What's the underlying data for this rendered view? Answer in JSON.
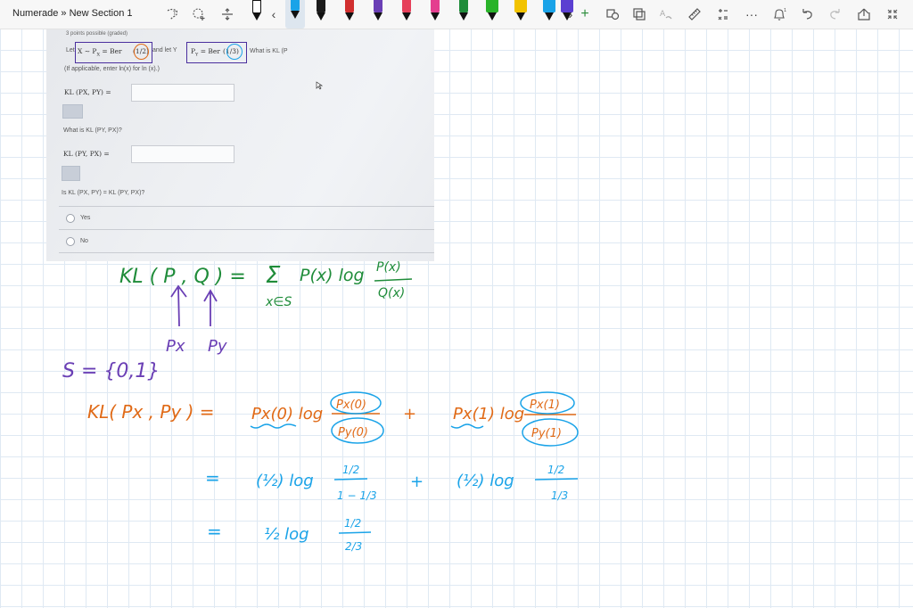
{
  "window": {
    "title": "Numerade » New Section 1"
  },
  "toolbar": {
    "icons": [
      "lasso-select-icon",
      "add-space-icon",
      "insert-space-icon",
      "pen-icon",
      "ruler-icon",
      "math-icon",
      "undo-icon",
      "redo-icon",
      "share-icon",
      "fullscreen-icon",
      "more-icon",
      "bell-icon"
    ],
    "pen_colors": [
      "#1b1b1b",
      "#1aa3e8",
      "#1b1b1b",
      "#d12f2f",
      "#6a3fb5",
      "#e6405a",
      "#e43e8f",
      "#1f8c3a",
      "#2ab32a",
      "#f2c300",
      "#1aa3e8",
      "#5b3fd1"
    ]
  },
  "problem": {
    "points": "3 points possible (graded)",
    "statement_pre": "Let",
    "statement_x": "X ∼ P",
    "statement_x_sub": "X",
    "statement_x_rhs": " = Ber",
    "statement_x_param": "(1/2)",
    "statement_mid": "and let Y",
    "statement_y": "P",
    "statement_y_sub": "Y",
    "statement_y_rhs": " = Ber",
    "statement_y_param": "(1/3)",
    "statement_q": "What is KL (P",
    "statement_q_tail": ")?",
    "hint": "(If applicable, enter ln(x) for ln (x).)",
    "q1_label": "KL (PX, PY) =",
    "q2_prompt": "What is KL (PY, PX)?",
    "q2_label": "KL (PY, PX) =",
    "q3_prompt": "Is KL (PX, PY) = KL (PY, PX)?",
    "options": [
      "Yes",
      "No"
    ]
  },
  "ink": {
    "green_def": "KL ( P , Q ) =",
    "green_sum": "Σ",
    "green_sum_sub": "x∈S",
    "green_term": "P(x) log",
    "green_num": "P(x)",
    "green_den": "Q(x)",
    "arrow_label_p": "Px",
    "arrow_label_q": "Py",
    "purple_set": "S = {0,1}",
    "orange_lhs": "KL( Px , Py ) =",
    "orange_t1": "Px(0) log",
    "orange_t1_num": "Px(0)",
    "orange_t1_den": "Py(0)",
    "orange_plus": "+",
    "orange_t2": "Px(1) log",
    "orange_t2_num": "Px(1)",
    "orange_t2_den": "Py(1)",
    "blue_eq1": "=",
    "blue_t1": "(½) log",
    "blue_t1_num": "1/2",
    "blue_t1_den": "1 − 1/3",
    "blue_plus": "+",
    "blue_t2": "(½) log",
    "blue_t2_num": "1/2",
    "blue_t2_den": "1/3",
    "blue_eq2": "=",
    "blue_t3": "½ log",
    "blue_t3_num": "1/2",
    "blue_t3_den": "2/3"
  }
}
